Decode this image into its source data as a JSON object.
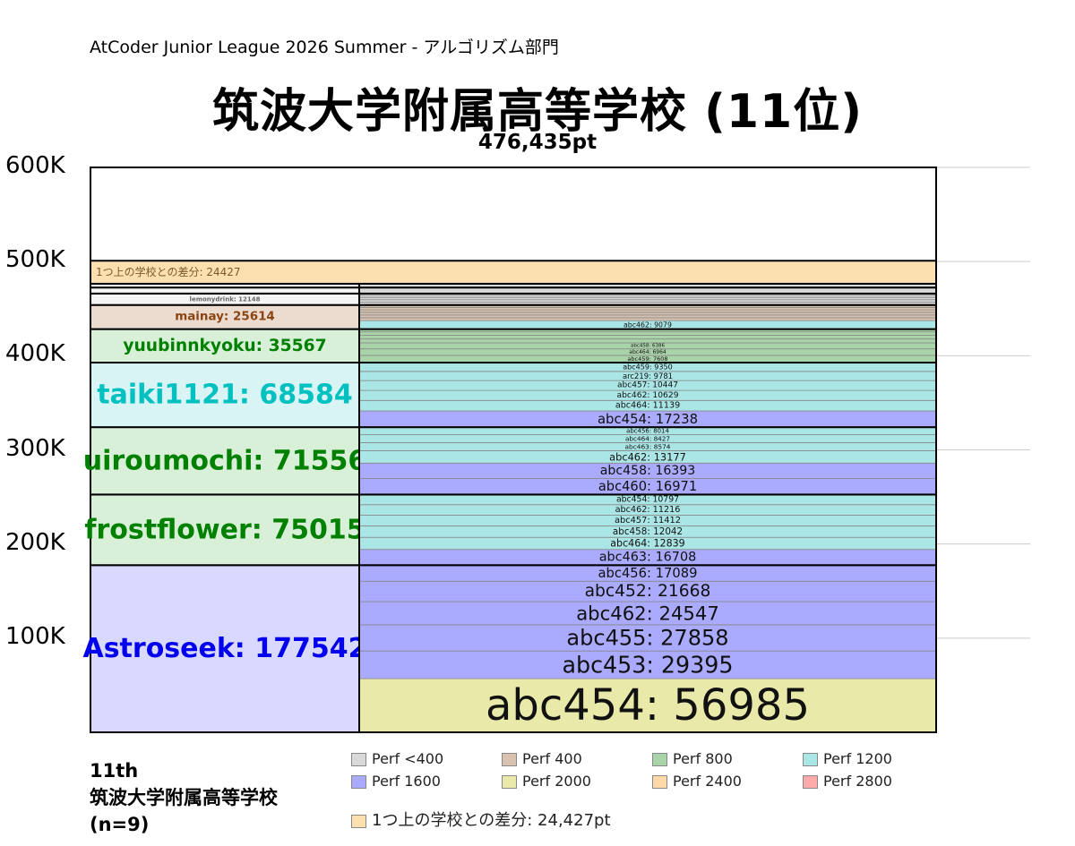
{
  "header": {
    "contest": "AtCoder Junior League 2026 Summer - アルゴリズム部門",
    "school_title": "筑波大学附属高等学校 (11位)",
    "total_points": "476,435pt"
  },
  "footer": {
    "rank": "11th",
    "school": "筑波大学附属高等学校",
    "count": "(n=9)"
  },
  "diff_note": "1つ上の学校との差分: 24,427pt",
  "legend": [
    {
      "label": "Perf <400",
      "color": "#d9d9d9"
    },
    {
      "label": "Perf 400",
      "color": "#d9c3b0"
    },
    {
      "label": "Perf 800",
      "color": "#a9d4a9"
    },
    {
      "label": "Perf 1200",
      "color": "#aae6e6"
    },
    {
      "label": "Perf 1600",
      "color": "#aaaaff"
    },
    {
      "label": "Perf 2000",
      "color": "#e9e9aa"
    },
    {
      "label": "Perf 2400",
      "color": "#fdd9aa"
    },
    {
      "label": "Perf 2800",
      "color": "#fdaaaa"
    }
  ],
  "chart_data": {
    "type": "bar",
    "ylim": [
      0,
      600000
    ],
    "yticks": [
      100000,
      200000,
      300000,
      400000,
      500000,
      600000
    ],
    "ytick_labels": [
      "100K",
      "200K",
      "300K",
      "400K",
      "500K",
      "600K"
    ],
    "grid": true,
    "gap_bar": {
      "label": "1つ上の学校との差分: 24427",
      "value": 24427,
      "color": "#fde0b0"
    },
    "members": [
      {
        "name": "Astroseek",
        "total": 177542,
        "label_color": "#0000ee",
        "fill": "#d9d9ff",
        "contests": [
          {
            "name": "abc454",
            "value": 56985,
            "color": "#e9e9aa"
          },
          {
            "name": "abc453",
            "value": 29395,
            "color": "#aaaaff"
          },
          {
            "name": "abc455",
            "value": 27858,
            "color": "#aaaaff"
          },
          {
            "name": "abc462",
            "value": 24547,
            "color": "#aaaaff"
          },
          {
            "name": "abc452",
            "value": 21668,
            "color": "#aaaaff"
          },
          {
            "name": "abc456",
            "value": 17089,
            "color": "#aaaaff"
          }
        ]
      },
      {
        "name": "frostflower",
        "total": 75015,
        "label_color": "#008000",
        "fill": "#d8efd8",
        "contests": [
          {
            "name": "abc463",
            "value": 16708,
            "color": "#aaaaff"
          },
          {
            "name": "abc464",
            "value": 12839,
            "color": "#aae6e6"
          },
          {
            "name": "abc458",
            "value": 12042,
            "color": "#aae6e6"
          },
          {
            "name": "abc457",
            "value": 11412,
            "color": "#aae6e6"
          },
          {
            "name": "abc462",
            "value": 11216,
            "color": "#aae6e6"
          },
          {
            "name": "abc454",
            "value": 10797,
            "color": "#aae6e6"
          }
        ]
      },
      {
        "name": "uiroumochi",
        "total": 71556,
        "label_color": "#008000",
        "fill": "#d8efd8",
        "contests": [
          {
            "name": "abc460",
            "value": 16971,
            "color": "#aaaaff"
          },
          {
            "name": "abc458",
            "value": 16393,
            "color": "#aaaaff"
          },
          {
            "name": "abc462",
            "value": 13177,
            "color": "#aae6e6"
          },
          {
            "name": "abc463",
            "value": 8574,
            "color": "#aae6e6"
          },
          {
            "name": "abc464",
            "value": 8427,
            "color": "#aae6e6"
          },
          {
            "name": "abc456",
            "value": 8014,
            "color": "#aae6e6"
          }
        ]
      },
      {
        "name": "taiki1121",
        "total": 68584,
        "label_color": "#00c0c0",
        "fill": "#d8f4f4",
        "contests": [
          {
            "name": "abc454",
            "value": 17238,
            "color": "#aaaaff"
          },
          {
            "name": "abc464",
            "value": 11139,
            "color": "#aae6e6"
          },
          {
            "name": "abc462",
            "value": 10629,
            "color": "#aae6e6"
          },
          {
            "name": "abc457",
            "value": 10447,
            "color": "#aae6e6"
          },
          {
            "name": "arc219",
            "value": 9781,
            "color": "#aae6e6"
          },
          {
            "name": "abc459",
            "value": 9350,
            "color": "#aae6e6"
          }
        ]
      },
      {
        "name": "yuubinnkyoku",
        "total": 35567,
        "label_color": "#008000",
        "fill": "#d8efd8",
        "contests": [
          {
            "name": "abc459",
            "value": 7608,
            "color": "#a9d4a9"
          },
          {
            "name": "abc464",
            "value": 6964,
            "color": "#a9d4a9"
          },
          {
            "name": "abc458",
            "value": 6386,
            "color": "#a9d4a9"
          },
          {
            "name": "",
            "value": 4100,
            "color": "#a9d4a9"
          },
          {
            "name": "",
            "value": 3900,
            "color": "#a9d4a9"
          },
          {
            "name": "",
            "value": 3700,
            "color": "#a9d4a9"
          },
          {
            "name": "",
            "value": 2909,
            "color": "#a9d4a9"
          }
        ]
      },
      {
        "name": "mainay",
        "total": 25614,
        "label_color": "#8b4513",
        "fill": "#ecdcd0",
        "contests": [
          {
            "name": "abc462",
            "value": 9079,
            "color": "#aae6e6"
          },
          {
            "name": "",
            "value": 3000,
            "color": "#d9c3b0"
          },
          {
            "name": "",
            "value": 2900,
            "color": "#d9c3b0"
          },
          {
            "name": "",
            "value": 2800,
            "color": "#d9c3b0"
          },
          {
            "name": "",
            "value": 2700,
            "color": "#d9c3b0"
          },
          {
            "name": "",
            "value": 2600,
            "color": "#d9c3b0"
          },
          {
            "name": "",
            "value": 2535,
            "color": "#d9c3b0"
          }
        ]
      },
      {
        "name": "lemonydrink",
        "total": 12148,
        "label_color": "#666666",
        "fill": "#f4f4f4",
        "contests": [
          {
            "name": "",
            "value": 3000,
            "color": "#d9d9d9"
          },
          {
            "name": "",
            "value": 2600,
            "color": "#d9d9d9"
          },
          {
            "name": "",
            "value": 2400,
            "color": "#d9d9d9"
          },
          {
            "name": "",
            "value": 2200,
            "color": "#d9d9d9"
          },
          {
            "name": "",
            "value": 1948,
            "color": "#d9d9d9"
          }
        ]
      },
      {
        "name": "",
        "total": 6400,
        "label_color": "#999999",
        "fill": "#f4f4f4",
        "contests": [
          {
            "name": "",
            "value": 6400,
            "color": "#d9d9d9"
          }
        ]
      },
      {
        "name": "",
        "total": 4009,
        "label_color": "#999999",
        "fill": "#f4f4f4",
        "contests": [
          {
            "name": "",
            "value": 4009,
            "color": "#d9d9d9"
          }
        ]
      }
    ]
  }
}
